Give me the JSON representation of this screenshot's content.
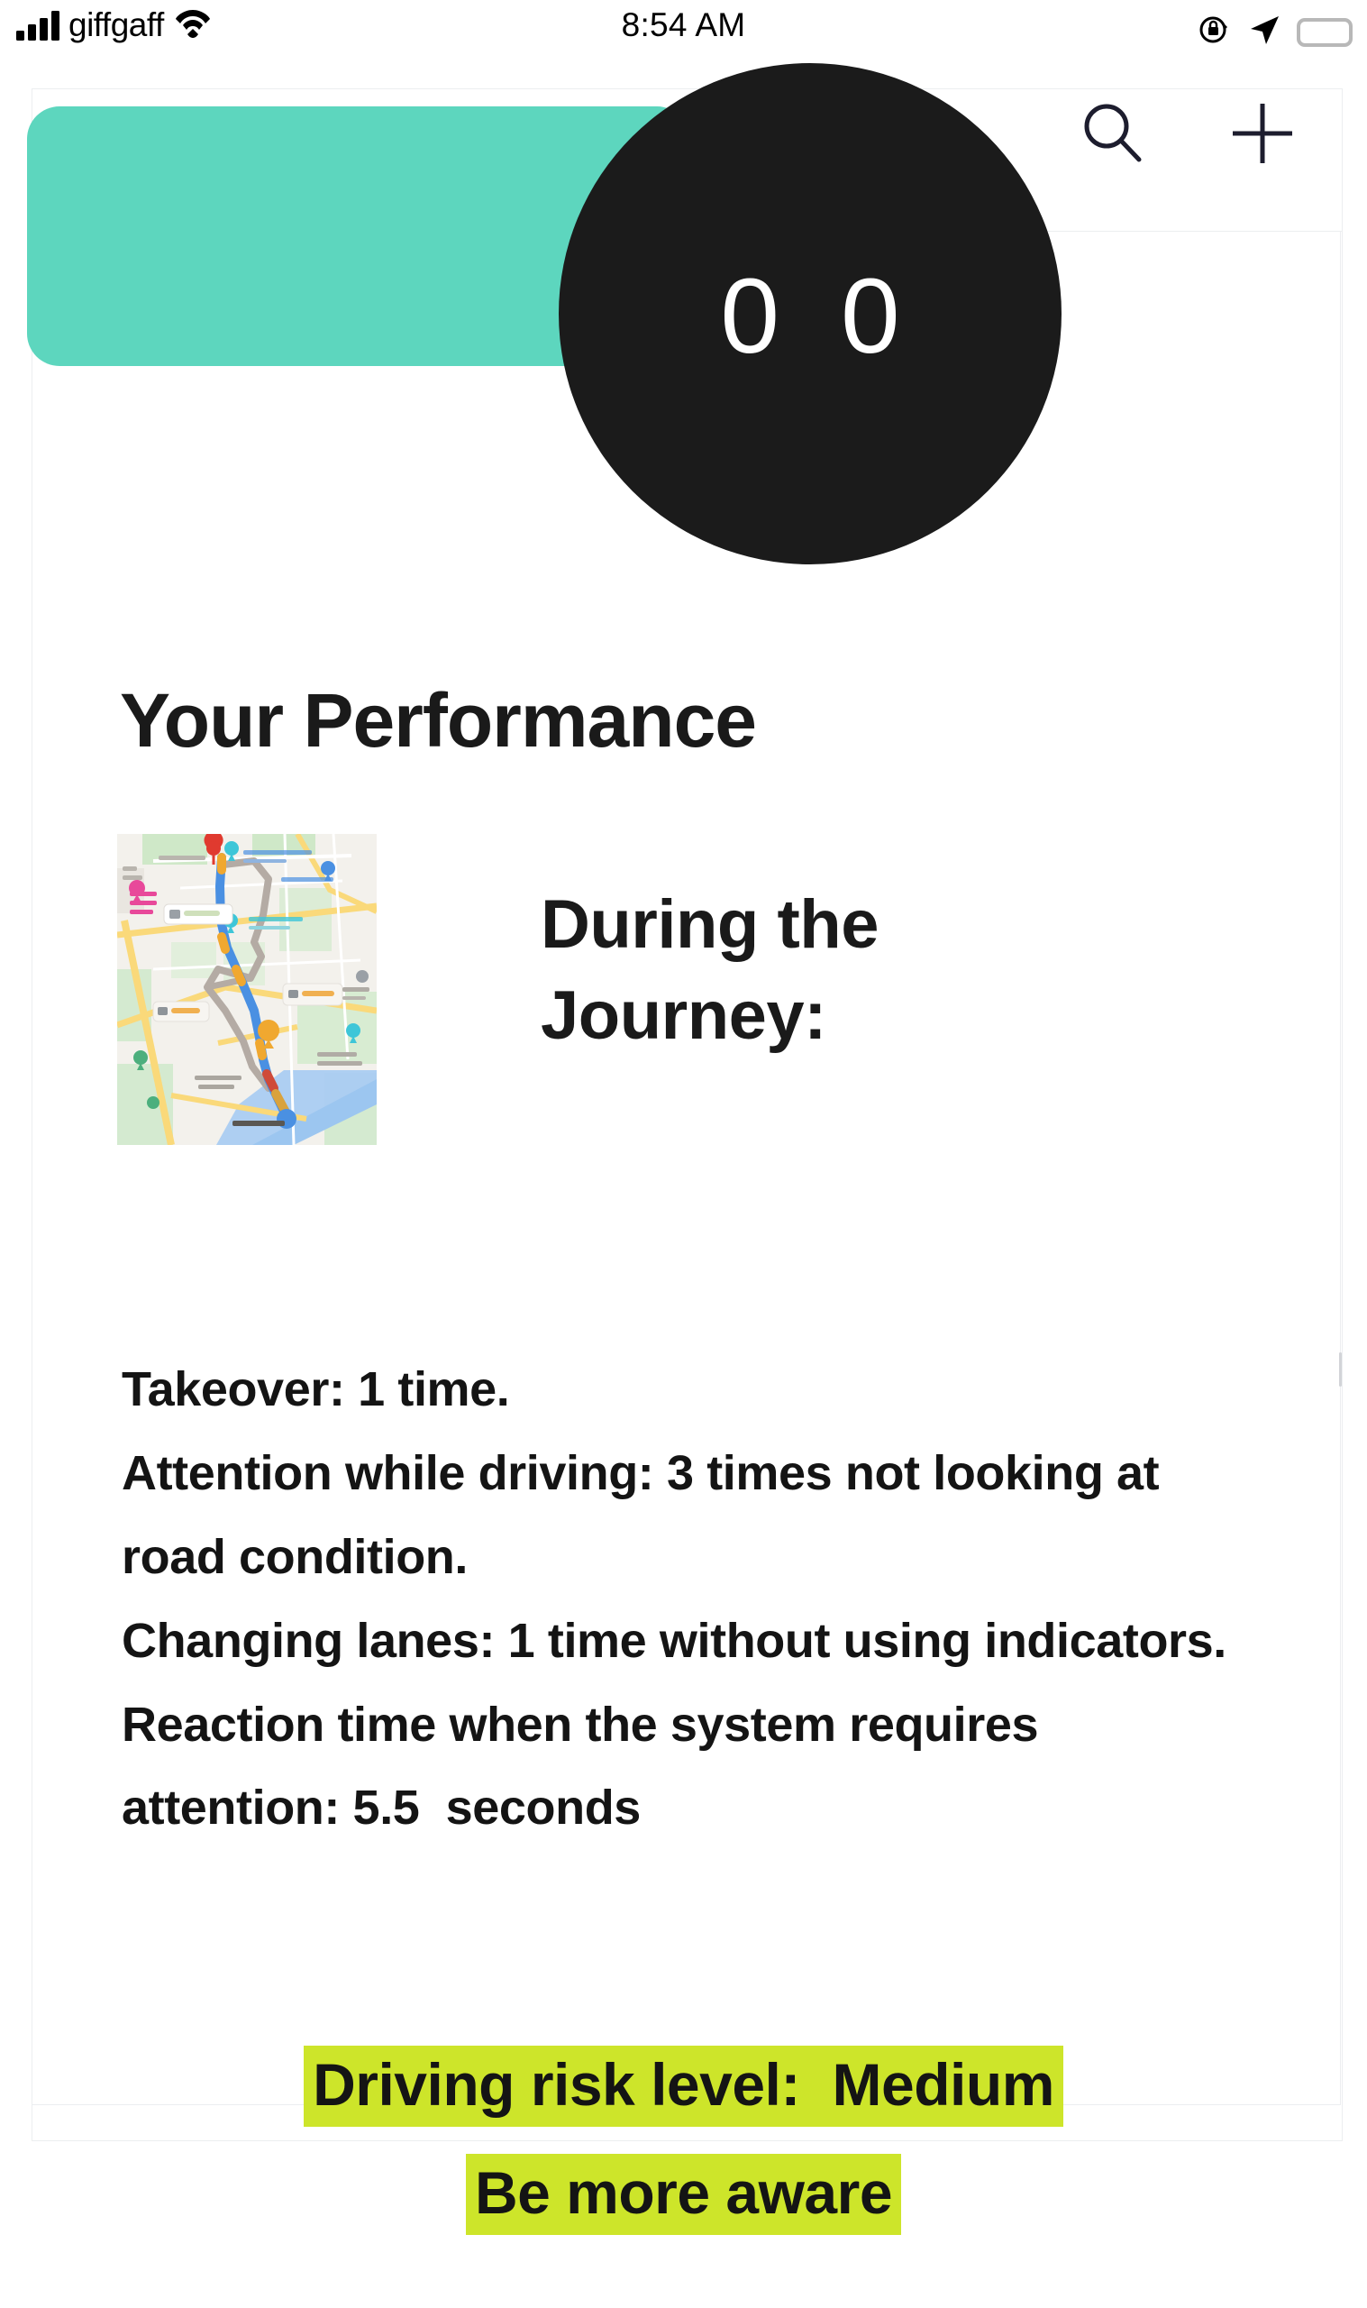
{
  "statusbar": {
    "carrier": "giffgaff",
    "time": "8:54 AM",
    "signal_icon": "signal-bars-icon",
    "wifi_icon": "wifi-icon",
    "rotation_lock_icon": "rotation-lock-icon",
    "location_icon": "location-arrow-icon",
    "battery_icon": "battery-full-icon"
  },
  "appbar": {
    "avatar_digit_left": "0",
    "avatar_digit_right": "0",
    "search_label": "search-icon",
    "add_label": "plus-icon",
    "teal_color": "#5dd6be",
    "avatar_color": "#1b1b1b"
  },
  "main": {
    "title": "Your Performance",
    "subtitle": "During the\nJourney:",
    "map_alt": "journey-route-map",
    "stats": [
      "Takeover: 1 time.",
      "Attention while driving: 3 times not looking at road condition.",
      "Changing lanes: 1 time without using indicators.",
      "Reaction time when the system requires attention: 5.5  seconds"
    ],
    "stats_text": "Takeover: 1 time.\nAttention while driving: 3 times not looking at road condition.\nChanging lanes: 1 time without using indicators.\nReaction time when the system requires attention: 5.5  seconds",
    "risk_line_1": "Driving risk level:  Medium",
    "risk_line_2": "Be more aware",
    "risk_level": "Medium",
    "highlight_color": "#cde52a"
  }
}
